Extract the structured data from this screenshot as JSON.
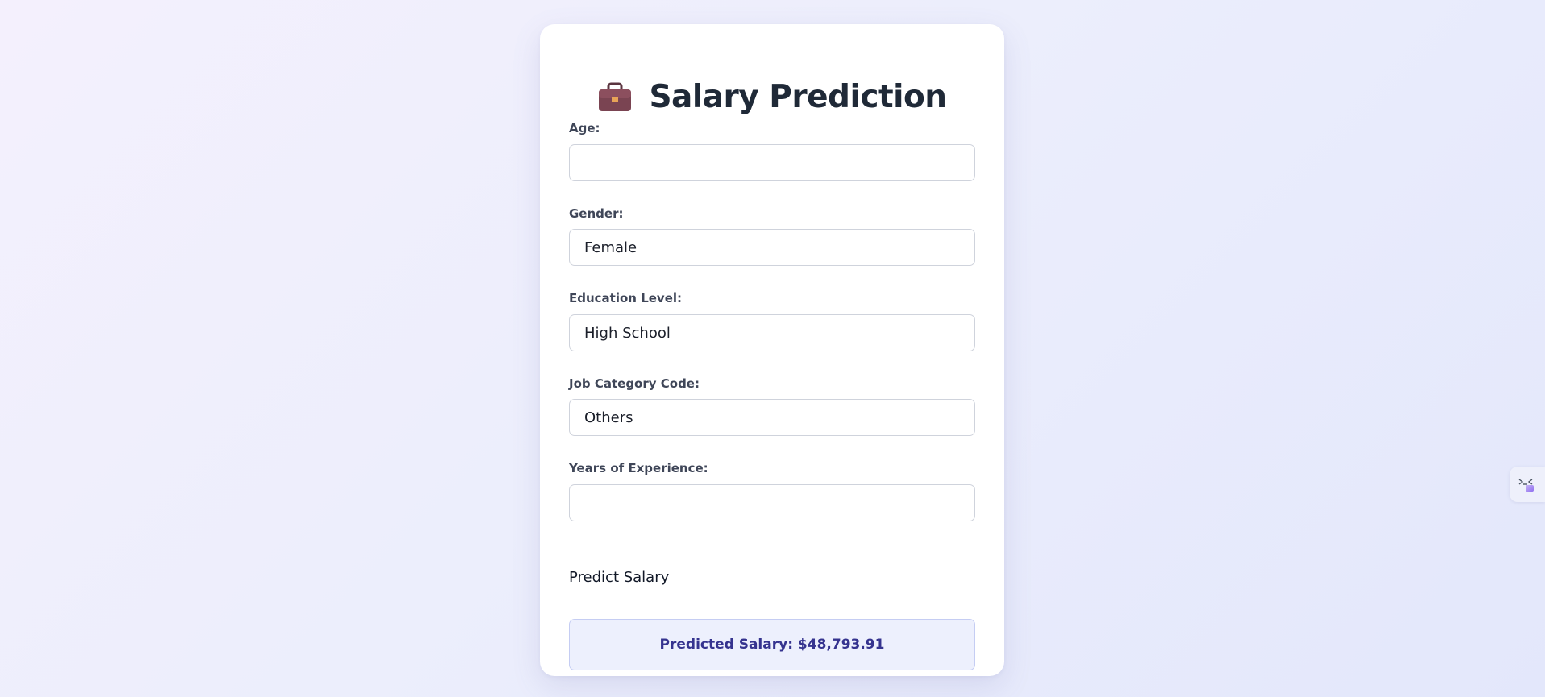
{
  "app": {
    "title": "Salary Prediction",
    "title_icon": "briefcase-icon"
  },
  "form": {
    "fields": [
      {
        "label": "Age:",
        "value": ""
      },
      {
        "label": "Gender:",
        "value": "Female"
      },
      {
        "label": "Education Level:",
        "value": "High School"
      },
      {
        "label": "Job Category Code:",
        "value": "Others"
      },
      {
        "label": "Years of Experience:",
        "value": ""
      }
    ],
    "predict_label": "Predict Salary"
  },
  "result": {
    "text": "Predicted Salary: $48,793.91"
  },
  "side_tab": {
    "icon": "dev-tools-icon"
  },
  "colors": {
    "card_background": "#ffffff",
    "title_text": "#1f2937",
    "result_background": "#edf0fd",
    "result_text": "#35338f",
    "page_gradient_start": "#f4f0fd",
    "page_gradient_end": "#e3e7fb"
  }
}
